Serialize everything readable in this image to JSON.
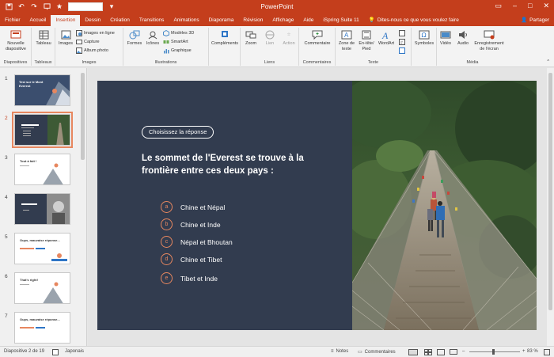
{
  "titlebar": {
    "title": "PowerPoint"
  },
  "tabs": [
    {
      "label": "Fichier"
    },
    {
      "label": "Accueil"
    },
    {
      "label": "Insertion"
    },
    {
      "label": "Dessin"
    },
    {
      "label": "Création"
    },
    {
      "label": "Transitions"
    },
    {
      "label": "Animations"
    },
    {
      "label": "Diaporama"
    },
    {
      "label": "Révision"
    },
    {
      "label": "Affichage"
    },
    {
      "label": "Aide"
    },
    {
      "label": "iSpring Suite 11"
    }
  ],
  "active_tab": "Insertion",
  "tell_me": "Dites-nous ce que vous voulez faire",
  "share": "Partager",
  "ribbon": {
    "groups": {
      "diapositives": "Diapositives",
      "tableaux": "Tableaux",
      "images": "Images",
      "illustrations": "Illustrations",
      "liens": "Liens",
      "commentaires": "Commentaires",
      "texte": "Texte",
      "media": "Média"
    },
    "nouvelle": "Nouvelle diapositive",
    "tableau": "Tableau",
    "images": "Images",
    "images_en_ligne": "Images en ligne",
    "capture": "Capture",
    "album": "Album photo",
    "formes": "Formes",
    "icones": "Icônes",
    "modeles3d": "Modèles 3D",
    "smartart": "SmartArt",
    "graphique": "Graphique",
    "complements": "Compléments",
    "zoom": "Zoom",
    "lien": "Lien",
    "action": "Action",
    "commentaire": "Commentaire",
    "zone_texte": "Zone de texte",
    "entete": "En-tête/ Pied",
    "wordart": "WordArt",
    "symboles": "Symboles",
    "video": "Vidéo",
    "audio": "Audio",
    "enregistrement": "Enregistrement de l'écran"
  },
  "thumbnails": [
    {
      "num": "1",
      "title": "Test sur le Mont Everest"
    },
    {
      "num": "2"
    },
    {
      "num": "3",
      "title": "Tout à fait !"
    },
    {
      "num": "4"
    },
    {
      "num": "5",
      "title": "Oups, mauvaise réponse..."
    },
    {
      "num": "6",
      "title": "That's right!"
    },
    {
      "num": "7",
      "title": "Oups, mauvaise réponse..."
    }
  ],
  "slide": {
    "pill": "Choisissez la réponse",
    "question": "Le sommet de l'Everest se trouve à la frontière entre ces deux pays :",
    "answers": [
      {
        "letter": "a",
        "text": "Chine et Népal"
      },
      {
        "letter": "b",
        "text": "Chine et Inde"
      },
      {
        "letter": "c",
        "text": "Népal et Bhoutan"
      },
      {
        "letter": "d",
        "text": "Chine et Tibet"
      },
      {
        "letter": "e",
        "text": "Tibet et Inde"
      }
    ]
  },
  "status": {
    "slide_info": "Diapositive 2 de 19",
    "language": "Japonais",
    "notes": "Notes",
    "comments": "Commentaires",
    "zoom": "83 %"
  },
  "colors": {
    "accent": "#c43e1c",
    "slide_bg": "#323c4f",
    "answer_accent": "#e7875f"
  }
}
